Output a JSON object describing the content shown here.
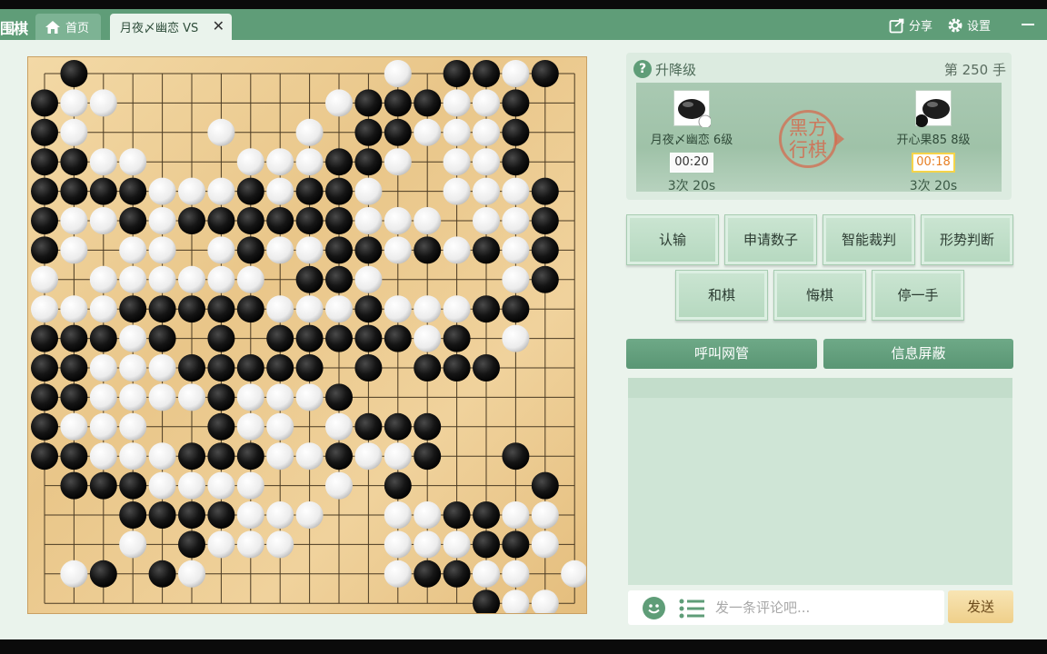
{
  "titlebar": {
    "app_logo": "围棋",
    "home_tab": "首页",
    "game_tab": "月夜〆幽恋 VS",
    "close_glyph": "✕",
    "share": "分享",
    "settings": "设置"
  },
  "panel": {
    "rank_label": "升降级",
    "move_counter": "第 250 手",
    "black": {
      "name": "月夜〆幽恋 6级",
      "timer": "00:20",
      "byoyomi": "3次  20s"
    },
    "white": {
      "name": "开心果85 8级",
      "timer": "00:18",
      "byoyomi": "3次  20s"
    },
    "room_line1": "黑方",
    "room_line2": "行棋"
  },
  "actions": {
    "resign": "认输",
    "count_request": "申请数子",
    "ai_judge": "智能裁判",
    "situation": "形势判断",
    "draw": "和棋",
    "undo": "悔棋",
    "pass": "停一手"
  },
  "bars": {
    "call_admin": "呼叫网管",
    "block_messages": "信息屏蔽"
  },
  "chat": {
    "placeholder": "发一条评论吧...",
    "send": "发送"
  },
  "colors": {
    "titlebar": "#5f9d78",
    "board": "#ecca8e",
    "accent": "#5f9d78",
    "seal": "#d46b4f"
  },
  "board": {
    "size": 19,
    "rows": [
      ".B..........W.BBWB.",
      "BWW.......WBBBWWB..",
      "BW....W..W.BBWWWB..",
      "BBWW...WWWBBW.WWB..",
      "BBBBWWWBWBBW..WWWB.",
      "BWWBWBBBBBBWWW.WWB.",
      "BW.WW.WBWWBBWBWBWB.",
      "W.WWWWWW.BBW....WB.",
      "WWWBBBBBWWWBWWWBB..",
      "BBBWB.B.BBBBBWB.W..",
      "BBWWWBBBBB.B.BBB...",
      "BBWWWWBWWWB........",
      "BWWW..BWW.WBBB.....",
      "BBWWWBBBWWBWWB..B..",
      ".BBBWWWW..W.B....B.",
      "...BBBBWWW..WWBBWW.",
      "...W.BWWW...WWWBBW.",
      ".WB.BW......WBBWW.W",
      "...............BWW."
    ]
  }
}
